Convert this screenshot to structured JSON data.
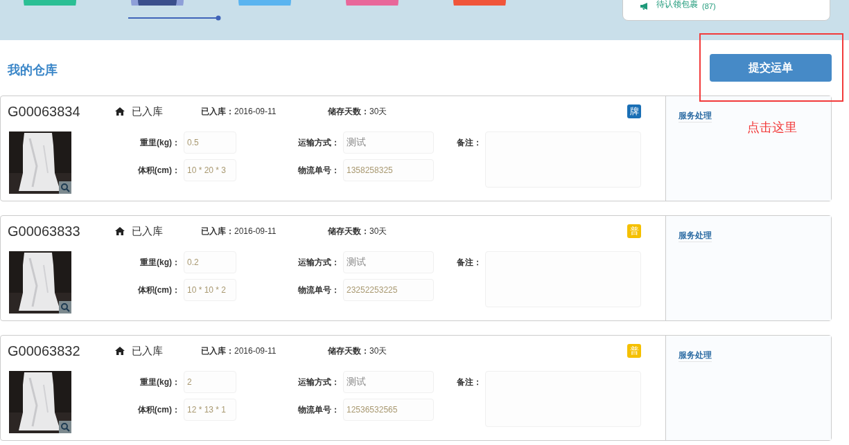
{
  "steps": [
    {
      "color": "#2bbf94",
      "selected": false
    },
    {
      "color": "#8e9fd8",
      "selected": true
    },
    {
      "color": "#5ab4f0",
      "selected": false
    },
    {
      "color": "#e8679a",
      "selected": false
    },
    {
      "color": "#f0553a",
      "selected": false
    }
  ],
  "notice": {
    "text": "待认领包裹",
    "count": "(87)"
  },
  "page_title": "我的仓库",
  "submit_button": "提交运单",
  "annotation": "点击这里",
  "packages": [
    {
      "id": "G00063834",
      "status": "已入库",
      "inbound_label": "已入库：",
      "inbound_date": "2016-09-11",
      "days_label": "储存天数：",
      "days": "30天",
      "badge": {
        "text": "牌",
        "color": "#1a6fb5"
      },
      "weight_label": "重里(kg)：",
      "weight": "0.5",
      "volume_label": "体积(cm)：",
      "volume": "10 * 20 * 3",
      "shipping_label": "运输方式：",
      "shipping": "测试",
      "tracking_label": "物流单号：",
      "tracking": "1358258325",
      "remark_label": "备注：",
      "service_link": "服务处理"
    },
    {
      "id": "G00063833",
      "status": "已入库",
      "inbound_label": "已入库：",
      "inbound_date": "2016-09-11",
      "days_label": "储存天数：",
      "days": "30天",
      "badge": {
        "text": "普",
        "color": "#f5c000"
      },
      "weight_label": "重里(kg)：",
      "weight": "0.2",
      "volume_label": "体积(cm)：",
      "volume": "10 * 10 * 2",
      "shipping_label": "运输方式：",
      "shipping": "测试",
      "tracking_label": "物流单号：",
      "tracking": "23252253225",
      "remark_label": "备注：",
      "service_link": "服务处理"
    },
    {
      "id": "G00063832",
      "status": "已入库",
      "inbound_label": "已入库：",
      "inbound_date": "2016-09-11",
      "days_label": "储存天数：",
      "days": "30天",
      "badge": {
        "text": "普",
        "color": "#f5c000"
      },
      "weight_label": "重里(kg)：",
      "weight": "2",
      "volume_label": "体积(cm)：",
      "volume": "12 * 13 * 1",
      "shipping_label": "运输方式：",
      "shipping": "测试",
      "tracking_label": "物流单号：",
      "tracking": "12536532565",
      "remark_label": "备注：",
      "service_link": "服务处理"
    }
  ]
}
